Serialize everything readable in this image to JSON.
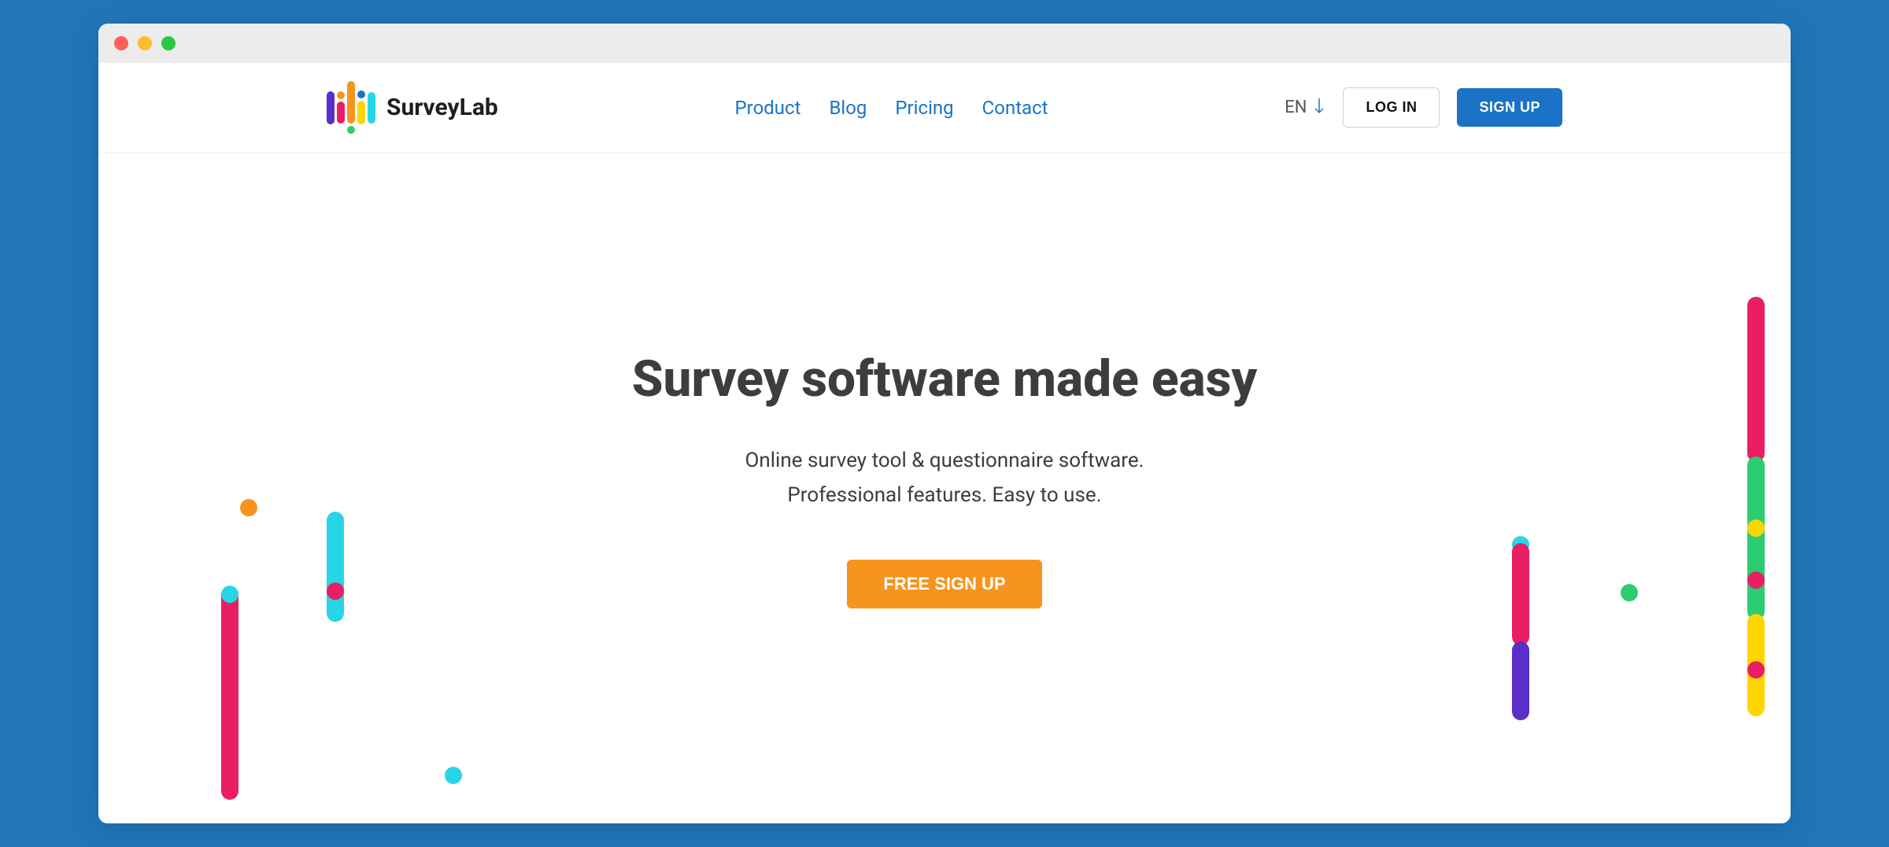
{
  "brand": {
    "name": "SurveyLab"
  },
  "nav": {
    "links": [
      "Product",
      "Blog",
      "Pricing",
      "Contact"
    ],
    "language": "EN",
    "login": "LOG IN",
    "signup": "SIGN UP"
  },
  "hero": {
    "title": "Survey software made easy",
    "subtitle_line1": "Online survey tool & questionnaire software.",
    "subtitle_line2": "Professional features. Easy to use.",
    "cta": "FREE SIGN UP"
  },
  "colors": {
    "blue": "#1a73c7",
    "orange": "#f7941e",
    "magenta": "#e91e63",
    "cyan": "#26d6e6",
    "green": "#2ecc71",
    "yellow": "#ffd500",
    "purple": "#5b2ec7"
  }
}
